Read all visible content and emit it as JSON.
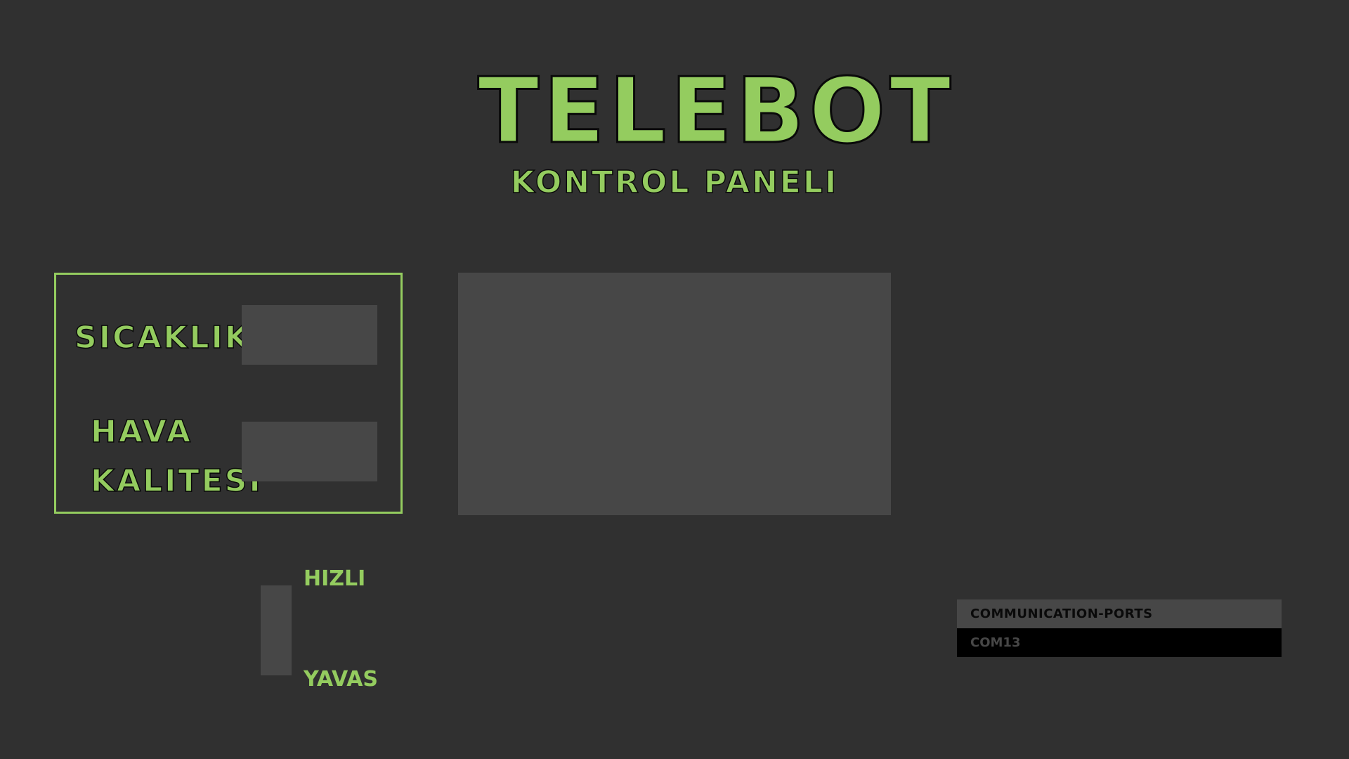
{
  "app": {
    "title": "TELEBOT",
    "subtitle": "KONTROL PANELI"
  },
  "sensors": {
    "temperature_label": "SICAKLIK",
    "air_quality_label_line1": "HAVA",
    "air_quality_label_line2": "KALITESI",
    "temperature_value": "",
    "air_quality_value": ""
  },
  "speed": {
    "fast_label": "HIZLI",
    "slow_label": "YAVAS"
  },
  "ports": {
    "header": "COMMUNICATION-PORTS",
    "items": [
      "COM13"
    ]
  },
  "colors": {
    "background": "#303030",
    "accent": "#94cc5f",
    "panel": "#474747",
    "outline": "#0a0a0a",
    "port_item_bg": "#000000"
  }
}
